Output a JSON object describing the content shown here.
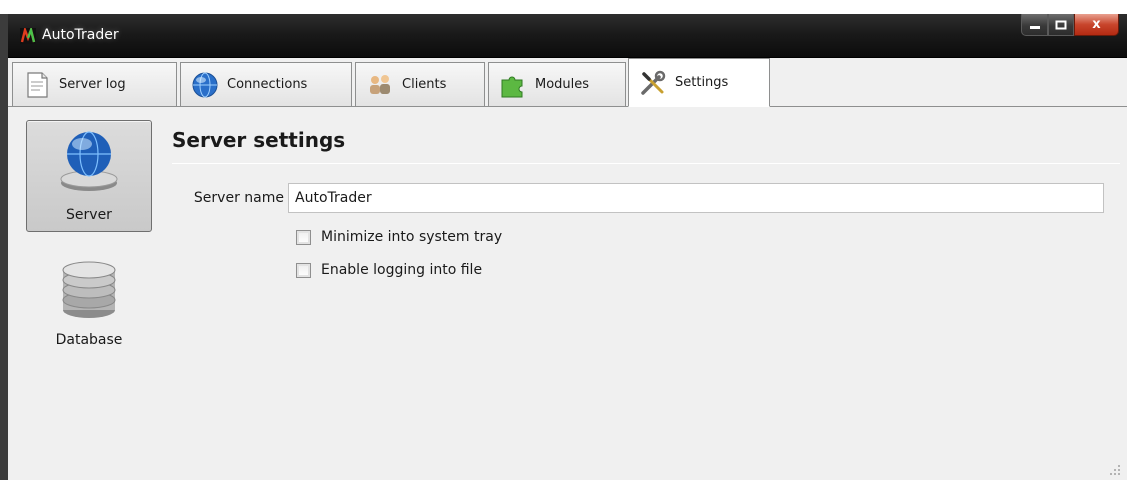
{
  "window": {
    "title": "AutoTrader",
    "app_icon": "autotrader-logo-icon",
    "controls": {
      "minimize_icon": "minimize-icon",
      "maximize_icon": "maximize-icon",
      "close_label": "x"
    }
  },
  "tabs": [
    {
      "label": "Server log",
      "icon": "document-icon",
      "active": false
    },
    {
      "label": "Connections",
      "icon": "globe-icon",
      "active": false
    },
    {
      "label": "Clients",
      "icon": "users-icon",
      "active": false
    },
    {
      "label": "Modules",
      "icon": "puzzle-icon",
      "active": false
    },
    {
      "label": "Settings",
      "icon": "tools-icon",
      "active": true
    }
  ],
  "sidebar": {
    "items": [
      {
        "label": "Server",
        "icon": "server-globe-icon",
        "selected": true
      },
      {
        "label": "Database",
        "icon": "database-icon",
        "selected": false
      }
    ]
  },
  "settings": {
    "title": "Server settings",
    "server_name": {
      "label": "Server name",
      "value": "AutoTrader"
    },
    "options": [
      {
        "label": "Minimize into system tray",
        "checked": false
      },
      {
        "label": "Enable logging into file",
        "checked": false
      }
    ]
  },
  "colors": {
    "titlebar": "#1a1a1a",
    "panel": "#f0f0f0",
    "close_button": "#c8452c"
  }
}
